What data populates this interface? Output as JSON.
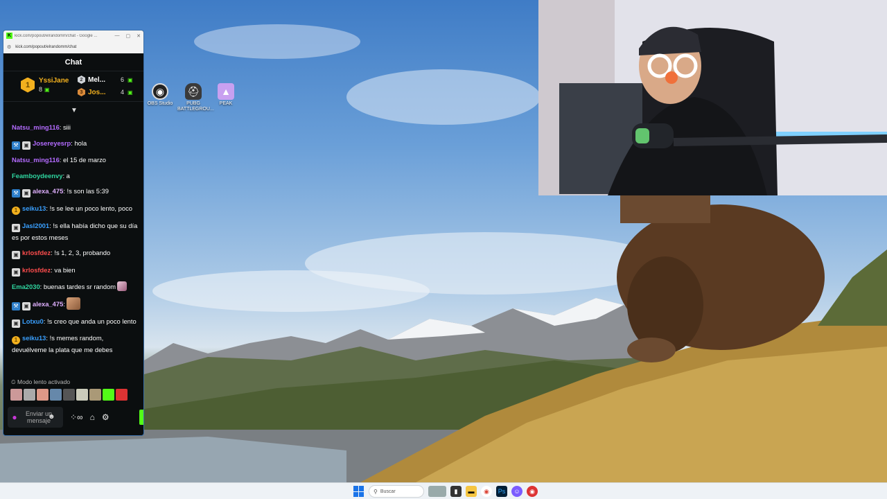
{
  "browser": {
    "title": "kick.com/popout/elrandomm/chat - Google ...",
    "url": "kick.com/popout/elrandomm/chat",
    "favicon": "K"
  },
  "chat": {
    "header": "Chat",
    "leaderboard": {
      "first": {
        "rank": "1",
        "name": "YssiJane",
        "count": "8"
      },
      "second": {
        "rank": "2",
        "name": "Mel...",
        "count": "6"
      },
      "third": {
        "rank": "3",
        "name": "Jos...",
        "count": "4"
      }
    },
    "messages": [
      {
        "badges": [],
        "user": "Natsu_ming116",
        "color": "#b36bff",
        "text": ": siii"
      },
      {
        "badges": [
          "sub",
          "ver"
        ],
        "user": "Josereyesrp",
        "color": "#b36bff",
        "text": ": hola"
      },
      {
        "badges": [],
        "user": "Natsu_ming116",
        "color": "#b36bff",
        "text": ": el 15 de marzo"
      },
      {
        "badges": [],
        "user": "Feamboydeenvy",
        "color": "#2fd6a0",
        "text": ": a"
      },
      {
        "badges": [
          "sub",
          "ver"
        ],
        "user": "alexa_475",
        "color": "#e0b0ff",
        "text": ": !s son las 5:39"
      },
      {
        "badges": [
          "coin"
        ],
        "user": "seiku13",
        "color": "#3aa0ff",
        "text": ": !s se lee un poco lento, poco"
      },
      {
        "badges": [
          "ver"
        ],
        "user": "Jasl2001",
        "color": "#3aa0ff",
        "text": ": !s ella había dicho que su día es por estos meses"
      },
      {
        "badges": [
          "ver"
        ],
        "user": "krlosfdez",
        "color": "#ff4d4d",
        "text": ": !s 1, 2, 3, probando"
      },
      {
        "badges": [
          "ver"
        ],
        "user": "krlosfdez",
        "color": "#ff4d4d",
        "text": ": va bien"
      },
      {
        "badges": [],
        "user": "Ema2030",
        "color": "#2fd6a0",
        "text": ": buenas tardes sr random"
      },
      {
        "badges": [
          "sub",
          "ver"
        ],
        "user": "alexa_475",
        "color": "#e0b0ff",
        "text": ":"
      },
      {
        "badges": [
          "ver"
        ],
        "user": "Lotxu0",
        "color": "#3aa0ff",
        "text": ": !s creo que anda un poco lento"
      },
      {
        "badges": [
          "coin"
        ],
        "user": "seiku13",
        "color": "#3aa0ff",
        "text": ": !s memes random, devuélveme la plata que me debes"
      }
    ],
    "slow_mode": "Modo lento activado",
    "input_placeholder": "Enviar un mensaje"
  },
  "desktop_icons": [
    {
      "label": "OBS Studio",
      "icon": "obs-icon"
    },
    {
      "label": "PUBG BATTLEGROU...",
      "icon": "pubg-icon"
    },
    {
      "label": "PEAK",
      "icon": "peak-icon"
    }
  ],
  "taskbar": {
    "search_placeholder": "Buscar"
  },
  "colors": {
    "kick_green": "#53fc18",
    "gold": "#f2b01e"
  }
}
